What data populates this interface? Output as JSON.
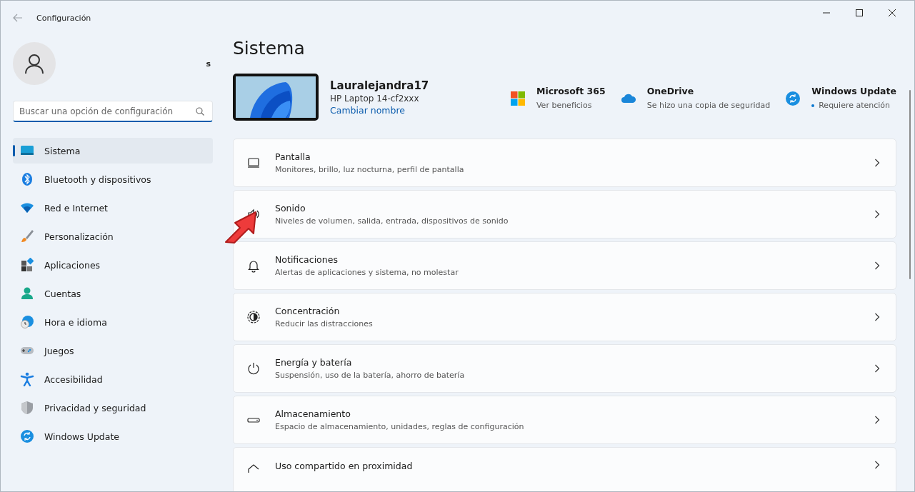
{
  "window": {
    "title": "Configuración"
  },
  "account": {
    "name": "s"
  },
  "search": {
    "placeholder": "Buscar una opción de configuración"
  },
  "sidebar": {
    "items": [
      {
        "label": "Sistema",
        "selected": true
      },
      {
        "label": "Bluetooth y dispositivos",
        "selected": false
      },
      {
        "label": "Red e Internet",
        "selected": false
      },
      {
        "label": "Personalización",
        "selected": false
      },
      {
        "label": "Aplicaciones",
        "selected": false
      },
      {
        "label": "Cuentas",
        "selected": false
      },
      {
        "label": "Hora e idioma",
        "selected": false
      },
      {
        "label": "Juegos",
        "selected": false
      },
      {
        "label": "Accesibilidad",
        "selected": false
      },
      {
        "label": "Privacidad y seguridad",
        "selected": false
      },
      {
        "label": "Windows Update",
        "selected": false
      }
    ]
  },
  "page": {
    "title": "Sistema"
  },
  "device": {
    "name": "Lauralejandra17",
    "model": "HP Laptop 14-cf2xxx",
    "rename_link": "Cambiar nombre"
  },
  "status_items": [
    {
      "title": "Microsoft 365",
      "subtitle": "Ver beneficios",
      "attention": false
    },
    {
      "title": "OneDrive",
      "subtitle": "Se hizo una copia de seguridad",
      "attention": false
    },
    {
      "title": "Windows Update",
      "subtitle": "Requiere atención",
      "attention": true
    }
  ],
  "settings": [
    {
      "title": "Pantalla",
      "description": "Monitores, brillo, luz nocturna, perfil de pantalla"
    },
    {
      "title": "Sonido",
      "description": "Niveles de volumen, salida, entrada, dispositivos de sonido"
    },
    {
      "title": "Notificaciones",
      "description": "Alertas de aplicaciones y sistema, no molestar"
    },
    {
      "title": "Concentración",
      "description": "Reducir las distracciones"
    },
    {
      "title": "Energía y batería",
      "description": "Suspensión, uso de la batería, ahorro de batería"
    },
    {
      "title": "Almacenamiento",
      "description": "Espacio de almacenamiento, unidades, reglas de configuración"
    },
    {
      "title": "Uso compartido en proximidad"
    }
  ]
}
